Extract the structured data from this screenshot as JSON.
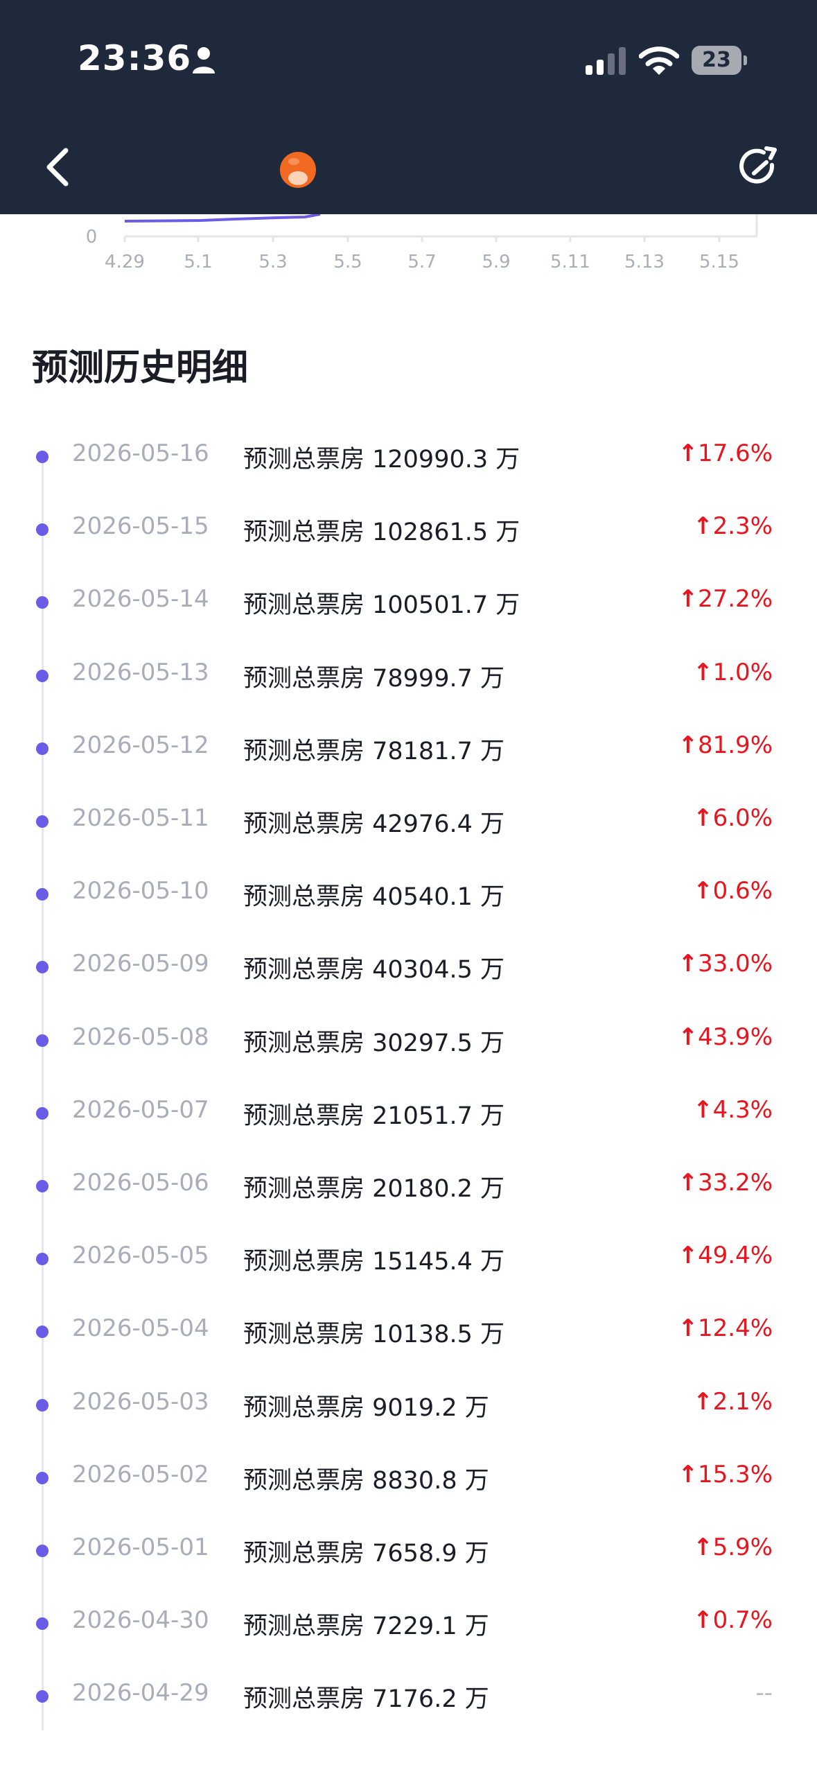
{
  "status_bar": {
    "time": "23:36",
    "battery_level": "23",
    "icons": [
      "person-icon",
      "signal-icon",
      "wifi-icon",
      "battery-icon"
    ]
  },
  "nav": {
    "back_icon": "chevron-left-icon",
    "logo_icon": "orange-logo-icon",
    "refresh_icon": "refresh-icon"
  },
  "colors": {
    "header_bg": "#1e2a3c",
    "accent": "#6b5ce7",
    "increase": "#e8141e"
  },
  "chart_data": {
    "type": "line",
    "x_tick_labels": [
      "4.29",
      "5.1",
      "5.3",
      "5.5",
      "5.7",
      "5.9",
      "5.11",
      "5.13",
      "5.15"
    ],
    "y_tick_labels": [
      "0"
    ]
  },
  "section": {
    "title": "预测历史明细"
  },
  "history": [
    {
      "date": "2026-05-16",
      "prediction": "预测总票房 120990.3 万",
      "change": "17.6%",
      "up": true
    },
    {
      "date": "2026-05-15",
      "prediction": "预测总票房 102861.5 万",
      "change": "2.3%",
      "up": true
    },
    {
      "date": "2026-05-14",
      "prediction": "预测总票房 100501.7 万",
      "change": "27.2%",
      "up": true
    },
    {
      "date": "2026-05-13",
      "prediction": "预测总票房 78999.7 万",
      "change": "1.0%",
      "up": true
    },
    {
      "date": "2026-05-12",
      "prediction": "预测总票房 78181.7 万",
      "change": "81.9%",
      "up": true
    },
    {
      "date": "2026-05-11",
      "prediction": "预测总票房 42976.4 万",
      "change": "6.0%",
      "up": true
    },
    {
      "date": "2026-05-10",
      "prediction": "预测总票房 40540.1 万",
      "change": "0.6%",
      "up": true
    },
    {
      "date": "2026-05-09",
      "prediction": "预测总票房 40304.5 万",
      "change": "33.0%",
      "up": true
    },
    {
      "date": "2026-05-08",
      "prediction": "预测总票房 30297.5 万",
      "change": "43.9%",
      "up": true
    },
    {
      "date": "2026-05-07",
      "prediction": "预测总票房 21051.7 万",
      "change": "4.3%",
      "up": true
    },
    {
      "date": "2026-05-06",
      "prediction": "预测总票房 20180.2 万",
      "change": "33.2%",
      "up": true
    },
    {
      "date": "2026-05-05",
      "prediction": "预测总票房 15145.4 万",
      "change": "49.4%",
      "up": true
    },
    {
      "date": "2026-05-04",
      "prediction": "预测总票房 10138.5 万",
      "change": "12.4%",
      "up": true
    },
    {
      "date": "2026-05-03",
      "prediction": "预测总票房 9019.2 万",
      "change": "2.1%",
      "up": true
    },
    {
      "date": "2026-05-02",
      "prediction": "预测总票房 8830.8 万",
      "change": "15.3%",
      "up": true
    },
    {
      "date": "2026-05-01",
      "prediction": "预测总票房 7658.9 万",
      "change": "5.9%",
      "up": true
    },
    {
      "date": "2026-04-30",
      "prediction": "预测总票房 7229.1 万",
      "change": "0.7%",
      "up": true
    },
    {
      "date": "2026-04-29",
      "prediction": "预测总票房 7176.2 万",
      "change": "--",
      "up": false
    }
  ]
}
